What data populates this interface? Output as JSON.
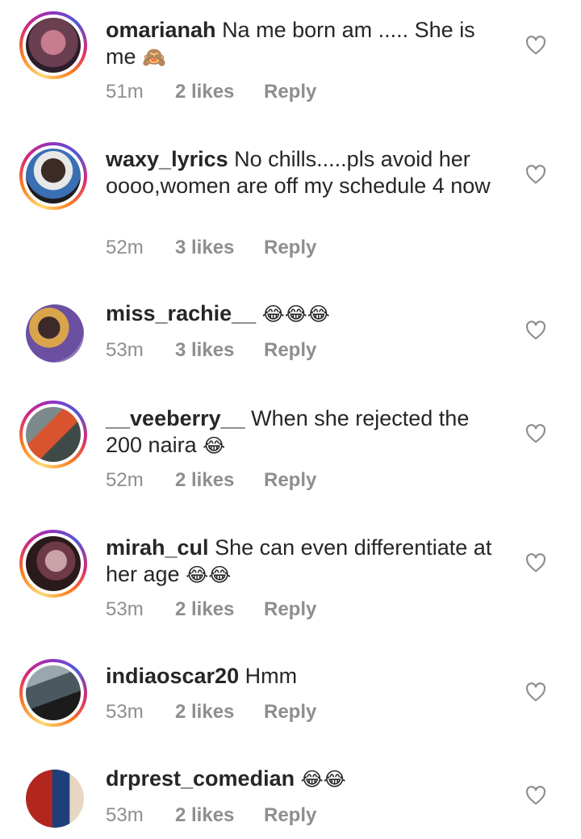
{
  "comments": [
    {
      "username": "omarianah",
      "text": "Na me born am ..... She is me",
      "emoji": "🙈",
      "time": "51m",
      "likes": "2 likes",
      "reply": "Reply",
      "avatar_ring": true,
      "avatar_colors": [
        "#6a3f4f",
        "#c77d8f",
        "#2b1e2a"
      ]
    },
    {
      "username": "waxy_lyrics",
      "text": "No chills.....pls avoid her oooo,women are off my schedule 4 now",
      "emoji": "",
      "time": "52m",
      "likes": "3 likes",
      "reply": "Reply",
      "avatar_ring": true,
      "avatar_colors": [
        "#1d1d1d",
        "#e8e8e8",
        "#3a6fb3"
      ]
    },
    {
      "username": "miss_rachie__",
      "text": "",
      "emoji": "😂😂😂",
      "time": "53m",
      "likes": "3 likes",
      "reply": "Reply",
      "avatar_ring": false,
      "avatar_colors": [
        "#6b4fa0",
        "#d9a44c",
        "#3c2a2a"
      ]
    },
    {
      "username": "__veeberry__",
      "text": "When she rejected the 200 naira",
      "emoji": "😂",
      "time": "52m",
      "likes": "2 likes",
      "reply": "Reply",
      "avatar_ring": true,
      "avatar_colors": [
        "#7d8a8c",
        "#d9542e",
        "#3f4a48"
      ]
    },
    {
      "username": "mirah_cul",
      "text": "She can even differentiate at her age",
      "emoji": "😂😂",
      "time": "53m",
      "likes": "2 likes",
      "reply": "Reply",
      "avatar_ring": true,
      "avatar_colors": [
        "#2a1a1c",
        "#caa3a8",
        "#6f3a47"
      ]
    },
    {
      "username": "indiaoscar20",
      "text": "Hmm",
      "emoji": "",
      "time": "53m",
      "likes": "2 likes",
      "reply": "Reply",
      "avatar_ring": true,
      "avatar_colors": [
        "#4a5860",
        "#1b1b1b",
        "#9aa7ae"
      ]
    },
    {
      "username": "drprest_comedian",
      "text": "",
      "emoji": "😂😂",
      "time": "53m",
      "likes": "2 likes",
      "reply": "Reply",
      "avatar_ring": false,
      "avatar_colors": [
        "#b3261e",
        "#1f3f7a",
        "#e7d7c2"
      ]
    }
  ],
  "heart_icon": "heart-outline-icon",
  "colors": {
    "text": "#262626",
    "secondary": "#8e8e8e",
    "heart": "#8e8e8e"
  }
}
